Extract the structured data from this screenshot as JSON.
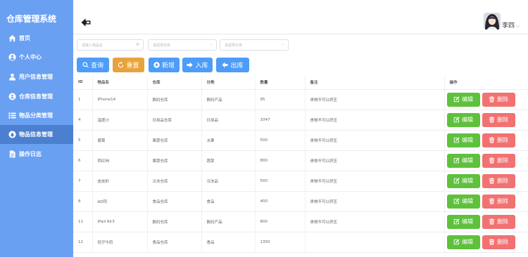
{
  "app": {
    "title": "仓库管理系统"
  },
  "sidebar": {
    "items": [
      {
        "label": "首页",
        "icon": "home-icon"
      },
      {
        "label": "个人中心",
        "icon": "user-circle-icon"
      },
      {
        "label": "用户信息管理",
        "icon": "users-icon"
      },
      {
        "label": "仓库信息管理",
        "icon": "warehouse-icon"
      },
      {
        "label": "物品分类管理",
        "icon": "list-icon"
      },
      {
        "label": "物品信息管理",
        "icon": "drop-icon",
        "active": true
      },
      {
        "label": "操作日志",
        "icon": "document-icon"
      }
    ]
  },
  "header": {
    "user_name": "李四",
    "caret": "⌵"
  },
  "filters": {
    "item_name_placeholder": "请输入物品名",
    "warehouse_placeholder": "请选择仓库",
    "category_placeholder": "请选择分类"
  },
  "toolbar": {
    "query_label": "查询",
    "reset_label": "重置",
    "add_label": "新增",
    "in_label": "入库",
    "out_label": "出库"
  },
  "table": {
    "headers": [
      "ID",
      "物品名",
      "仓库",
      "分类",
      "数量",
      "备注",
      "操作"
    ],
    "rows": [
      [
        "1",
        "iPhone14",
        "数码仓库",
        "数码产品",
        "95",
        "贵物不可以挤压"
      ],
      [
        "4",
        "温度计",
        "日用品仓库",
        "日用品",
        "1047",
        "贵物不可以挤压"
      ],
      [
        "5",
        "葡萄",
        "果蔬仓库",
        "水果",
        "500",
        "贵物不可以挤压"
      ],
      [
        "6",
        "西红柿",
        "果蔬仓库",
        "蔬菜",
        "800",
        "贵物不可以挤压"
      ],
      [
        "7",
        "皮皮虾",
        "冷冻仓库",
        "冷冻品",
        "500",
        "贵物不可以挤压"
      ],
      [
        "8",
        "AD钙",
        "食品仓库",
        "食品",
        "400",
        "贵物不可以挤压"
      ],
      [
        "11",
        "iPad Air3",
        "数码仓库",
        "数码产品",
        "800",
        "贵物不可以挤压"
      ],
      [
        "12",
        "旺仔牛奶",
        "食品仓库",
        "食品",
        "1350",
        ""
      ]
    ],
    "edit_label": "编辑",
    "delete_label": "删除"
  },
  "colors": {
    "sidebar": "#6aa0f2",
    "sidebar_active": "#4b7fd0",
    "primary": "#4d9cf8",
    "warning": "#e8a33d",
    "success": "#5ec13c",
    "danger": "#f27171"
  }
}
